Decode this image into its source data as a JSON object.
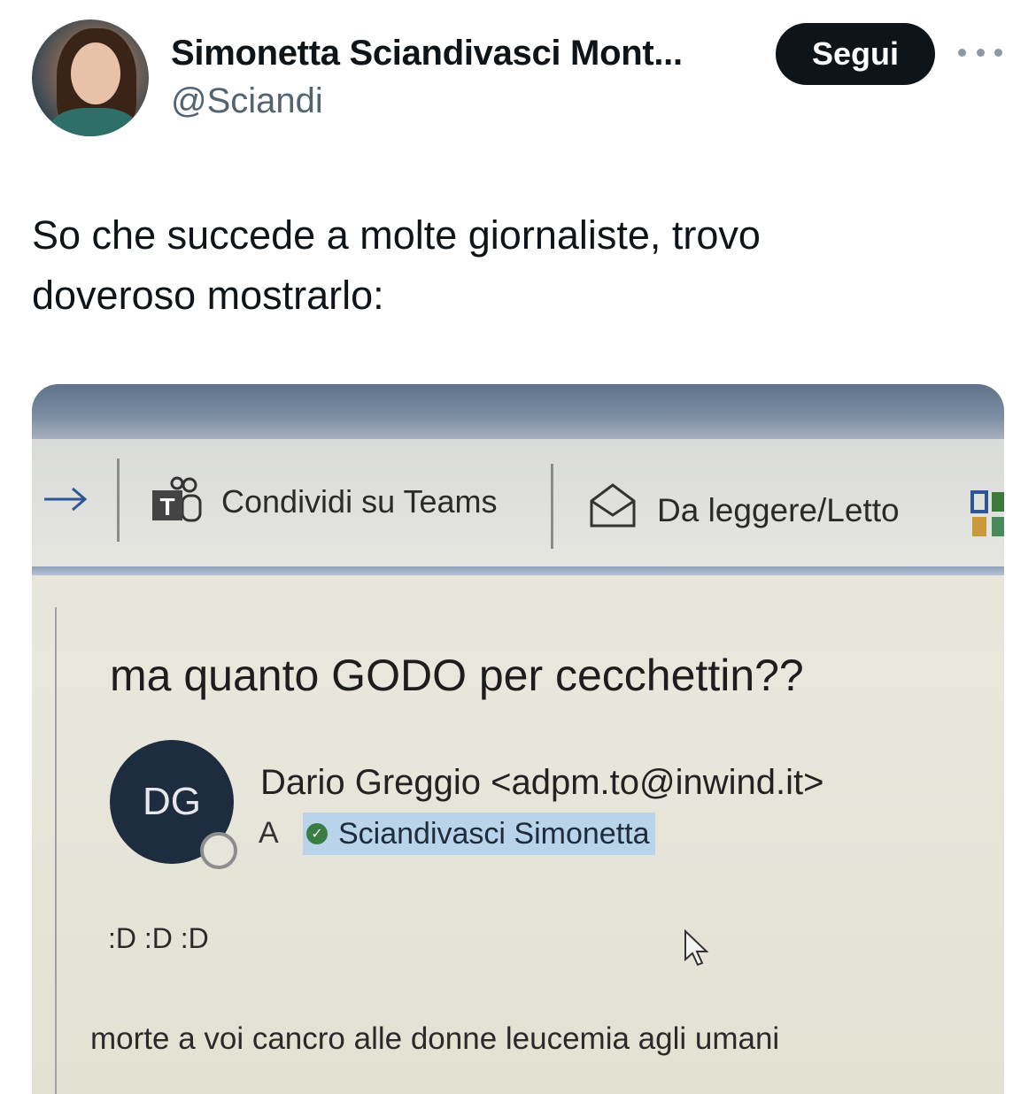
{
  "author": {
    "display_name": "Simonetta Sciandivasci Mont...",
    "handle": "@Sciandi",
    "follow_label": "Segui"
  },
  "tweet": {
    "text_line1": "So che succede a molte giornaliste, trovo",
    "text_line2": "doveroso mostrarlo:"
  },
  "photo": {
    "toolbar": {
      "share_teams_label": "Condividi su Teams",
      "read_unread_label": "Da leggere/Letto"
    },
    "email": {
      "subject": "ma quanto GODO per cecchettin??",
      "avatar_initials": "DG",
      "sender": "Dario Greggio <adpm.to@inwind.it>",
      "to_prefix": "A",
      "recipient": "Sciandivasci Simonetta",
      "body_line1": ":D :D :D",
      "body_line2": "morte a voi cancro alle donne leucemia agli umani"
    }
  },
  "icons": [
    "more-options-icon",
    "forward-arrow-icon",
    "teams-icon",
    "envelope-open-icon",
    "apps-grid-icon",
    "verified-check-icon",
    "cursor-icon"
  ],
  "colors": {
    "follow_bg": "#0f1419",
    "handle": "#536471",
    "recipient_highlight": "#b9d3ea",
    "avatar_dg": "#1e2c3f"
  }
}
